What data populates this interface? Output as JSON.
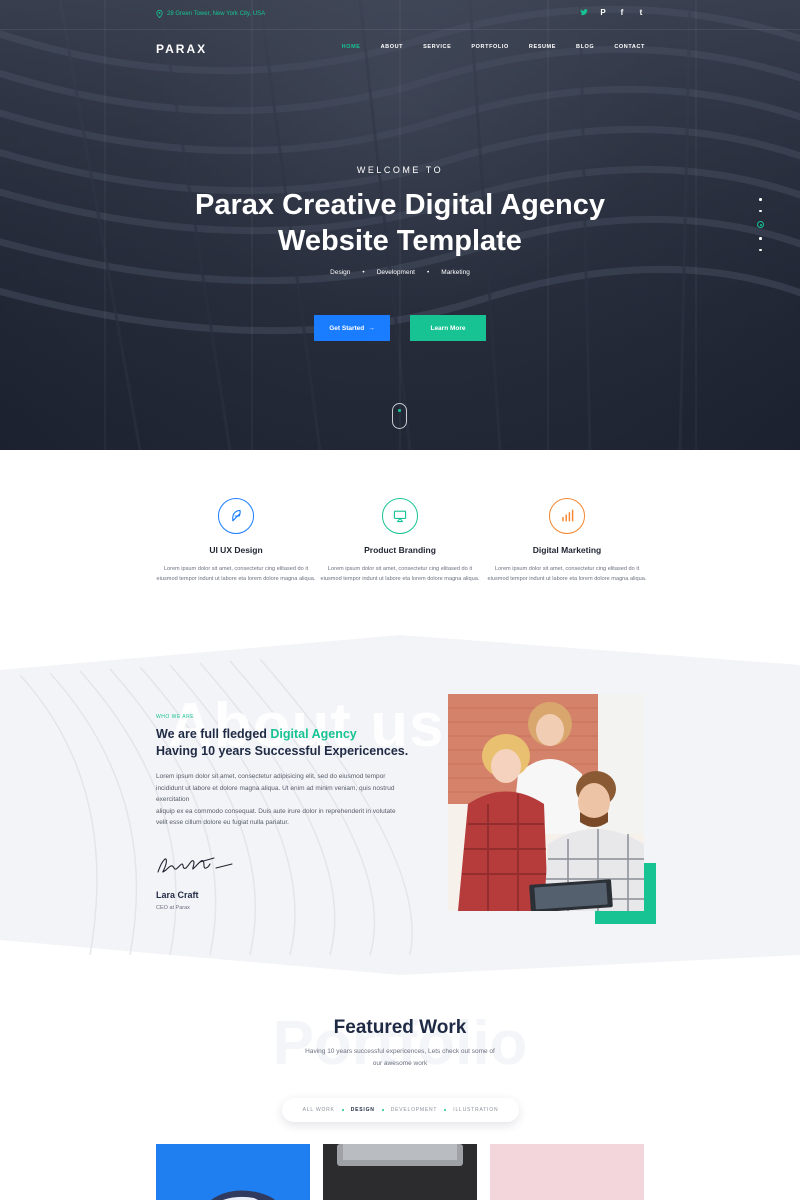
{
  "topbar": {
    "address": "28 Green Tower, New York City, USA",
    "social_icons": [
      "twitter-icon",
      "pinterest-icon",
      "facebook-icon",
      "tumblr-icon"
    ]
  },
  "nav": {
    "logo": "PARAX",
    "items": [
      "HOME",
      "ABOUT",
      "SERVICE",
      "PORTFOLIO",
      "RESUME",
      "BLOG",
      "CONTACT"
    ],
    "active": "HOME"
  },
  "hero": {
    "welcome": "WELCOME TO",
    "title_line1": "Parax Creative Digital Agency",
    "title_line2": "Website Template",
    "tags": [
      "Design",
      "Development",
      "Marketing"
    ],
    "btn_start": "Get Started",
    "btn_more": "Learn More"
  },
  "services": [
    {
      "title": "UI UX Design",
      "text": "Lorem ipsum dolor sit amet, consectetur cing elitased do it eiusmod tempor indunt ut labore eta lorem dolore magna aliqua.",
      "icon": "feather-icon",
      "color": "#1a7cff"
    },
    {
      "title": "Product Branding",
      "text": "Lorem ipsum dolor sit amet, consectetur cing elitased do it eiusmod tempor indunt ut labore eta lorem dolore magna aliqua.",
      "icon": "monitor-icon",
      "color": "#17c393"
    },
    {
      "title": "Digital Marketing",
      "text": "Lorem ipsum dolor sit amet, consectetur cing elitased do it eiusmod tempor indunt ut labore eta lorem dolore magna aliqua.",
      "icon": "bar-chart-icon",
      "color": "#f5862e"
    }
  ],
  "about": {
    "watermark": "About us",
    "eyebrow": "WHO WE ARE",
    "heading_pre": "We are full fledged ",
    "heading_highlight": "Digital Agency",
    "heading_line2": "Having 10 years Successful Expericences.",
    "para1": "Lorem ipsum dolor sit amet, consectetur adipisicing elit, sed do eiusmod tempor incididunt ut labore et dolore magna aliqua. Ut enim ad minim veniam, quis nostrud exercitation",
    "para2": "aliquip ex ea commodo consequat. Duis aute irure dolor in reprehenderit in volutate velit esse cillum dolore eu fugiat nulla pariatur.",
    "name": "Lara Craft",
    "role": "CEO at Parax"
  },
  "portfolio": {
    "watermark": "Portfolio",
    "title": "Featured Work",
    "subtitle": "Having 10 years successful expericences, Lets check out some of our awesome work",
    "filters": [
      "ALL WORK",
      "DESIGN",
      "DEVELOPMENT",
      "ILLUSTRATION"
    ],
    "active_filter": "DESIGN"
  },
  "colors": {
    "accent": "#17c393",
    "primary": "#1a7cff",
    "orange": "#f5862e",
    "dark": "#1f2a44"
  }
}
